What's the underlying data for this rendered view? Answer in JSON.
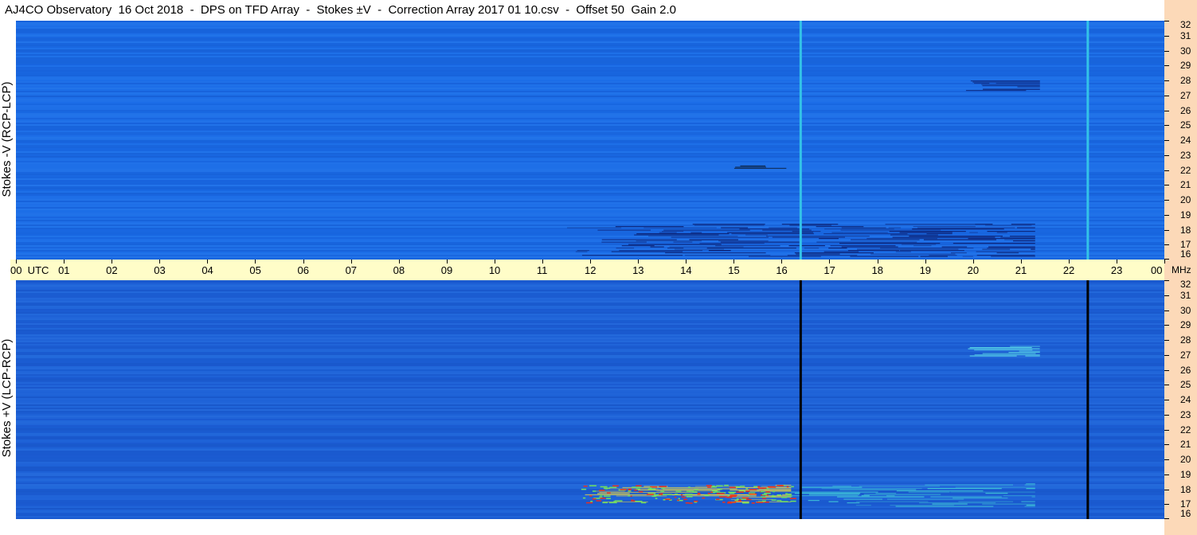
{
  "title": "AJ4CO Observatory  16 Oct 2018  -  DPS on TFD Array  -  Stokes ±V  -  Correction Array 2017 01 10.csv  -  Offset 50  Gain 2.0",
  "chart_data": [
    {
      "type": "heatmap",
      "panel": "top",
      "ylabel": "Stokes -V (RCP-LCP)",
      "x_unit": "UTC hour",
      "y_unit": "MHz",
      "xlim": [
        0,
        24
      ],
      "ylim": [
        16,
        32
      ],
      "y_ticks": [
        "16",
        "17",
        "18",
        "19",
        "20",
        "21",
        "22",
        "23",
        "24",
        "25",
        "26",
        "27",
        "28",
        "29",
        "30",
        "31",
        "32"
      ],
      "background_color": "#1a6be6",
      "burst_color": "#0a1a6a",
      "vertical_lines": [
        {
          "hour": 16.4,
          "color": "#33c3e8"
        },
        {
          "hour": 22.4,
          "color": "#33c3e8"
        }
      ],
      "burst_regions": [
        {
          "start_hour": 11.2,
          "end_hour": 21.3,
          "freq_low": 16.2,
          "freq_high": 18.4,
          "color": "#0a1a6a"
        },
        {
          "start_hour": 19.8,
          "end_hour": 21.4,
          "freq_low": 27.3,
          "freq_high": 28.0,
          "color": "#0a1a6a"
        },
        {
          "start_hour": 15.0,
          "end_hour": 16.1,
          "freq_low": 22.1,
          "freq_high": 22.3,
          "color": "#050505"
        }
      ]
    },
    {
      "type": "heatmap",
      "panel": "bottom",
      "ylabel": "Stokes +V (LCP-RCP)",
      "x_unit": "UTC hour",
      "y_unit": "MHz",
      "xlim": [
        0,
        24
      ],
      "ylim": [
        16,
        32
      ],
      "y_ticks": [
        "16",
        "17",
        "18",
        "19",
        "20",
        "21",
        "22",
        "23",
        "24",
        "25",
        "26",
        "27",
        "28",
        "29",
        "30",
        "31",
        "32"
      ],
      "background_color": "#1c5fd6",
      "burst_color": "#f0e040",
      "vertical_lines": [
        {
          "hour": 16.4,
          "color": "#000000"
        },
        {
          "hour": 22.4,
          "color": "#000000"
        }
      ],
      "burst_regions": [
        {
          "start_hour": 11.8,
          "end_hour": 16.2,
          "freq_low": 17.1,
          "freq_high": 18.3,
          "color": "#f0d840"
        },
        {
          "start_hour": 16.0,
          "end_hour": 21.3,
          "freq_low": 16.8,
          "freq_high": 18.4,
          "color": "#40c8d8"
        },
        {
          "start_hour": 19.8,
          "end_hour": 21.4,
          "freq_low": 26.9,
          "freq_high": 27.6,
          "color": "#5ad8e8"
        }
      ]
    }
  ],
  "time_axis": {
    "labels": [
      "00  UTC",
      "01",
      "02",
      "03",
      "04",
      "05",
      "06",
      "07",
      "08",
      "09",
      "10",
      "11",
      "12",
      "13",
      "14",
      "15",
      "16",
      "17",
      "18",
      "19",
      "20",
      "21",
      "22",
      "23",
      "00"
    ],
    "unit_label": "MHz"
  }
}
